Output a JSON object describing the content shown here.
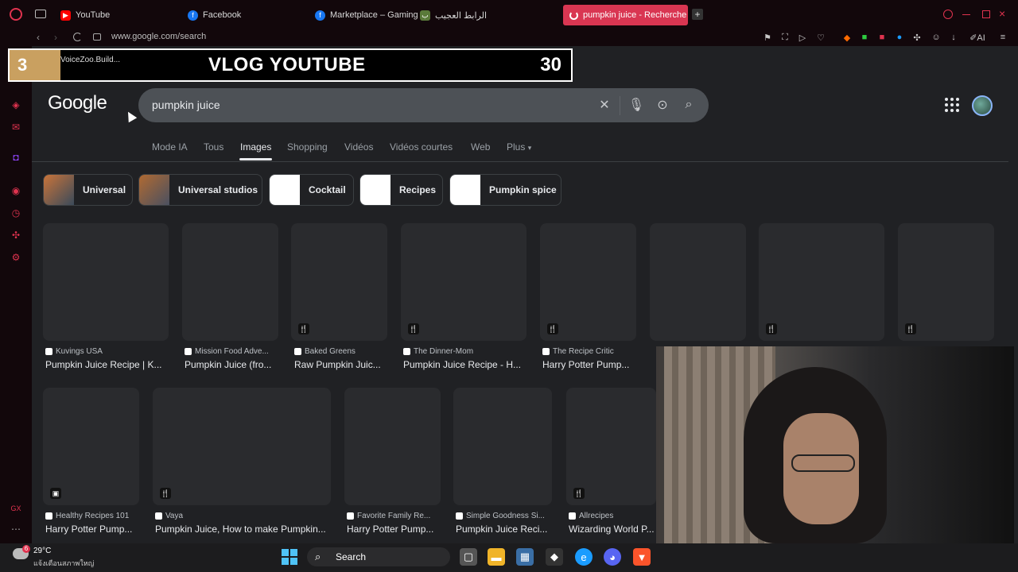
{
  "browser": {
    "tabs": [
      {
        "label": "YouTube",
        "icon": "youtube-icon"
      },
      {
        "label": "Facebook",
        "icon": "facebook-icon"
      },
      {
        "label": "Marketplace – Gaming Co",
        "icon": "facebook-icon"
      },
      {
        "label": "الرابط العجيب",
        "icon": "site-icon"
      },
      {
        "label": "pumpkin juice - Recherche",
        "icon": "loading-icon"
      }
    ],
    "url": "www.google.com/search"
  },
  "overlay": {
    "number": "3",
    "subtitle": "VoiceZoo.Build...",
    "title": "VLOG YOUTUBE",
    "count": "30"
  },
  "google": {
    "logo": "Google",
    "query": "pumpkin juice",
    "nav_tabs": [
      "Mode IA",
      "Tous",
      "Images",
      "Shopping",
      "Vidéos",
      "Vidéos courtes",
      "Web",
      "Plus"
    ],
    "active_tab": "Images",
    "chips": [
      "Universal",
      "Universal studios",
      "Cocktail",
      "Recipes",
      "Pumpkin spice"
    ],
    "row1": [
      {
        "source": "Kuvings USA",
        "title": "Pumpkin Juice Recipe | K..."
      },
      {
        "source": "Mission Food Adve...",
        "title": "Pumpkin Juice (fro..."
      },
      {
        "source": "Baked Greens",
        "title": "Raw Pumpkin Juic..."
      },
      {
        "source": "The Dinner-Mom",
        "title": "Pumpkin Juice Recipe - H..."
      },
      {
        "source": "The Recipe Critic",
        "title": "Harry Potter Pump..."
      }
    ],
    "row2": [
      {
        "source": "Healthy Recipes 101",
        "title": "Harry Potter Pump..."
      },
      {
        "source": "Vaya",
        "title": "Pumpkin Juice, How to make Pumpkin..."
      },
      {
        "source": "Favorite Family Re...",
        "title": "Harry Potter Pump..."
      },
      {
        "source": "Simple Goodness Si...",
        "title": "Pumpkin Juice Reci..."
      },
      {
        "source": "Allrecipes",
        "title": "Wizarding World P..."
      }
    ]
  },
  "taskbar": {
    "temperature": "29°C",
    "weather_text": "แจ้งเตือนสภาพใหญ่",
    "weather_badge": "6",
    "search_label": "Search"
  }
}
